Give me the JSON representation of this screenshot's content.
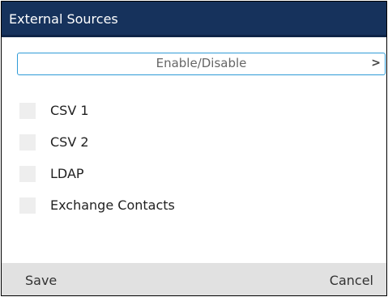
{
  "header": {
    "title": "External Sources"
  },
  "selector": {
    "label": "Enable/Disable",
    "chevron_icon": "chevron-right-icon",
    "chevron_glyph": ">"
  },
  "sources": [
    {
      "label": "CSV 1",
      "checked": false
    },
    {
      "label": "CSV 2",
      "checked": false
    },
    {
      "label": "LDAP",
      "checked": false
    },
    {
      "label": "Exchange Contacts",
      "checked": false
    }
  ],
  "footer": {
    "save_label": "Save",
    "cancel_label": "Cancel"
  },
  "colors": {
    "header_bg": "#16325c",
    "accent": "#2f9bd7",
    "footer_bg": "#e1e1e1",
    "checkbox_bg": "#eeeeee"
  }
}
